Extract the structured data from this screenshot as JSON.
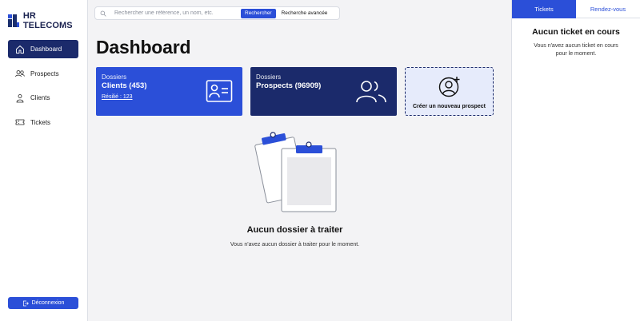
{
  "brand": {
    "name": "HR TELECOMS"
  },
  "sidebar": {
    "items": [
      {
        "label": "Dashboard",
        "icon": "home-icon",
        "active": true
      },
      {
        "label": "Prospects",
        "icon": "users-icon",
        "active": false
      },
      {
        "label": "Clients",
        "icon": "user-icon",
        "active": false
      },
      {
        "label": "Tickets",
        "icon": "ticket-icon",
        "active": false
      }
    ],
    "logout_label": "Déconnexion"
  },
  "search": {
    "placeholder": "Rechercher une référence, un nom, etc.",
    "value": "",
    "search_button": "Rechercher",
    "advanced_link": "Recherche avancée"
  },
  "main": {
    "title": "Dashboard",
    "cards": {
      "clients": {
        "label": "Dossiers",
        "title": "Clients (453)",
        "link": "Résilié : 123"
      },
      "prospects": {
        "label": "Dossiers",
        "title": "Prospects (96909)"
      },
      "new_prospect": {
        "label": "Créer un nouveau prospect"
      }
    },
    "empty": {
      "title": "Aucun dossier à traiter",
      "description": "Vous n'avez aucun dossier à traiter pour le moment."
    }
  },
  "right_panel": {
    "tabs": [
      {
        "label": "Tickets",
        "active": true
      },
      {
        "label": "Rendez-vous",
        "active": false
      }
    ],
    "title": "Aucun ticket en cours",
    "description": "Vous n'avez aucun ticket en cours pour le moment."
  },
  "colors": {
    "primary": "#2b4fd8",
    "navy": "#1b2a6b",
    "background": "#f3f3f5"
  }
}
